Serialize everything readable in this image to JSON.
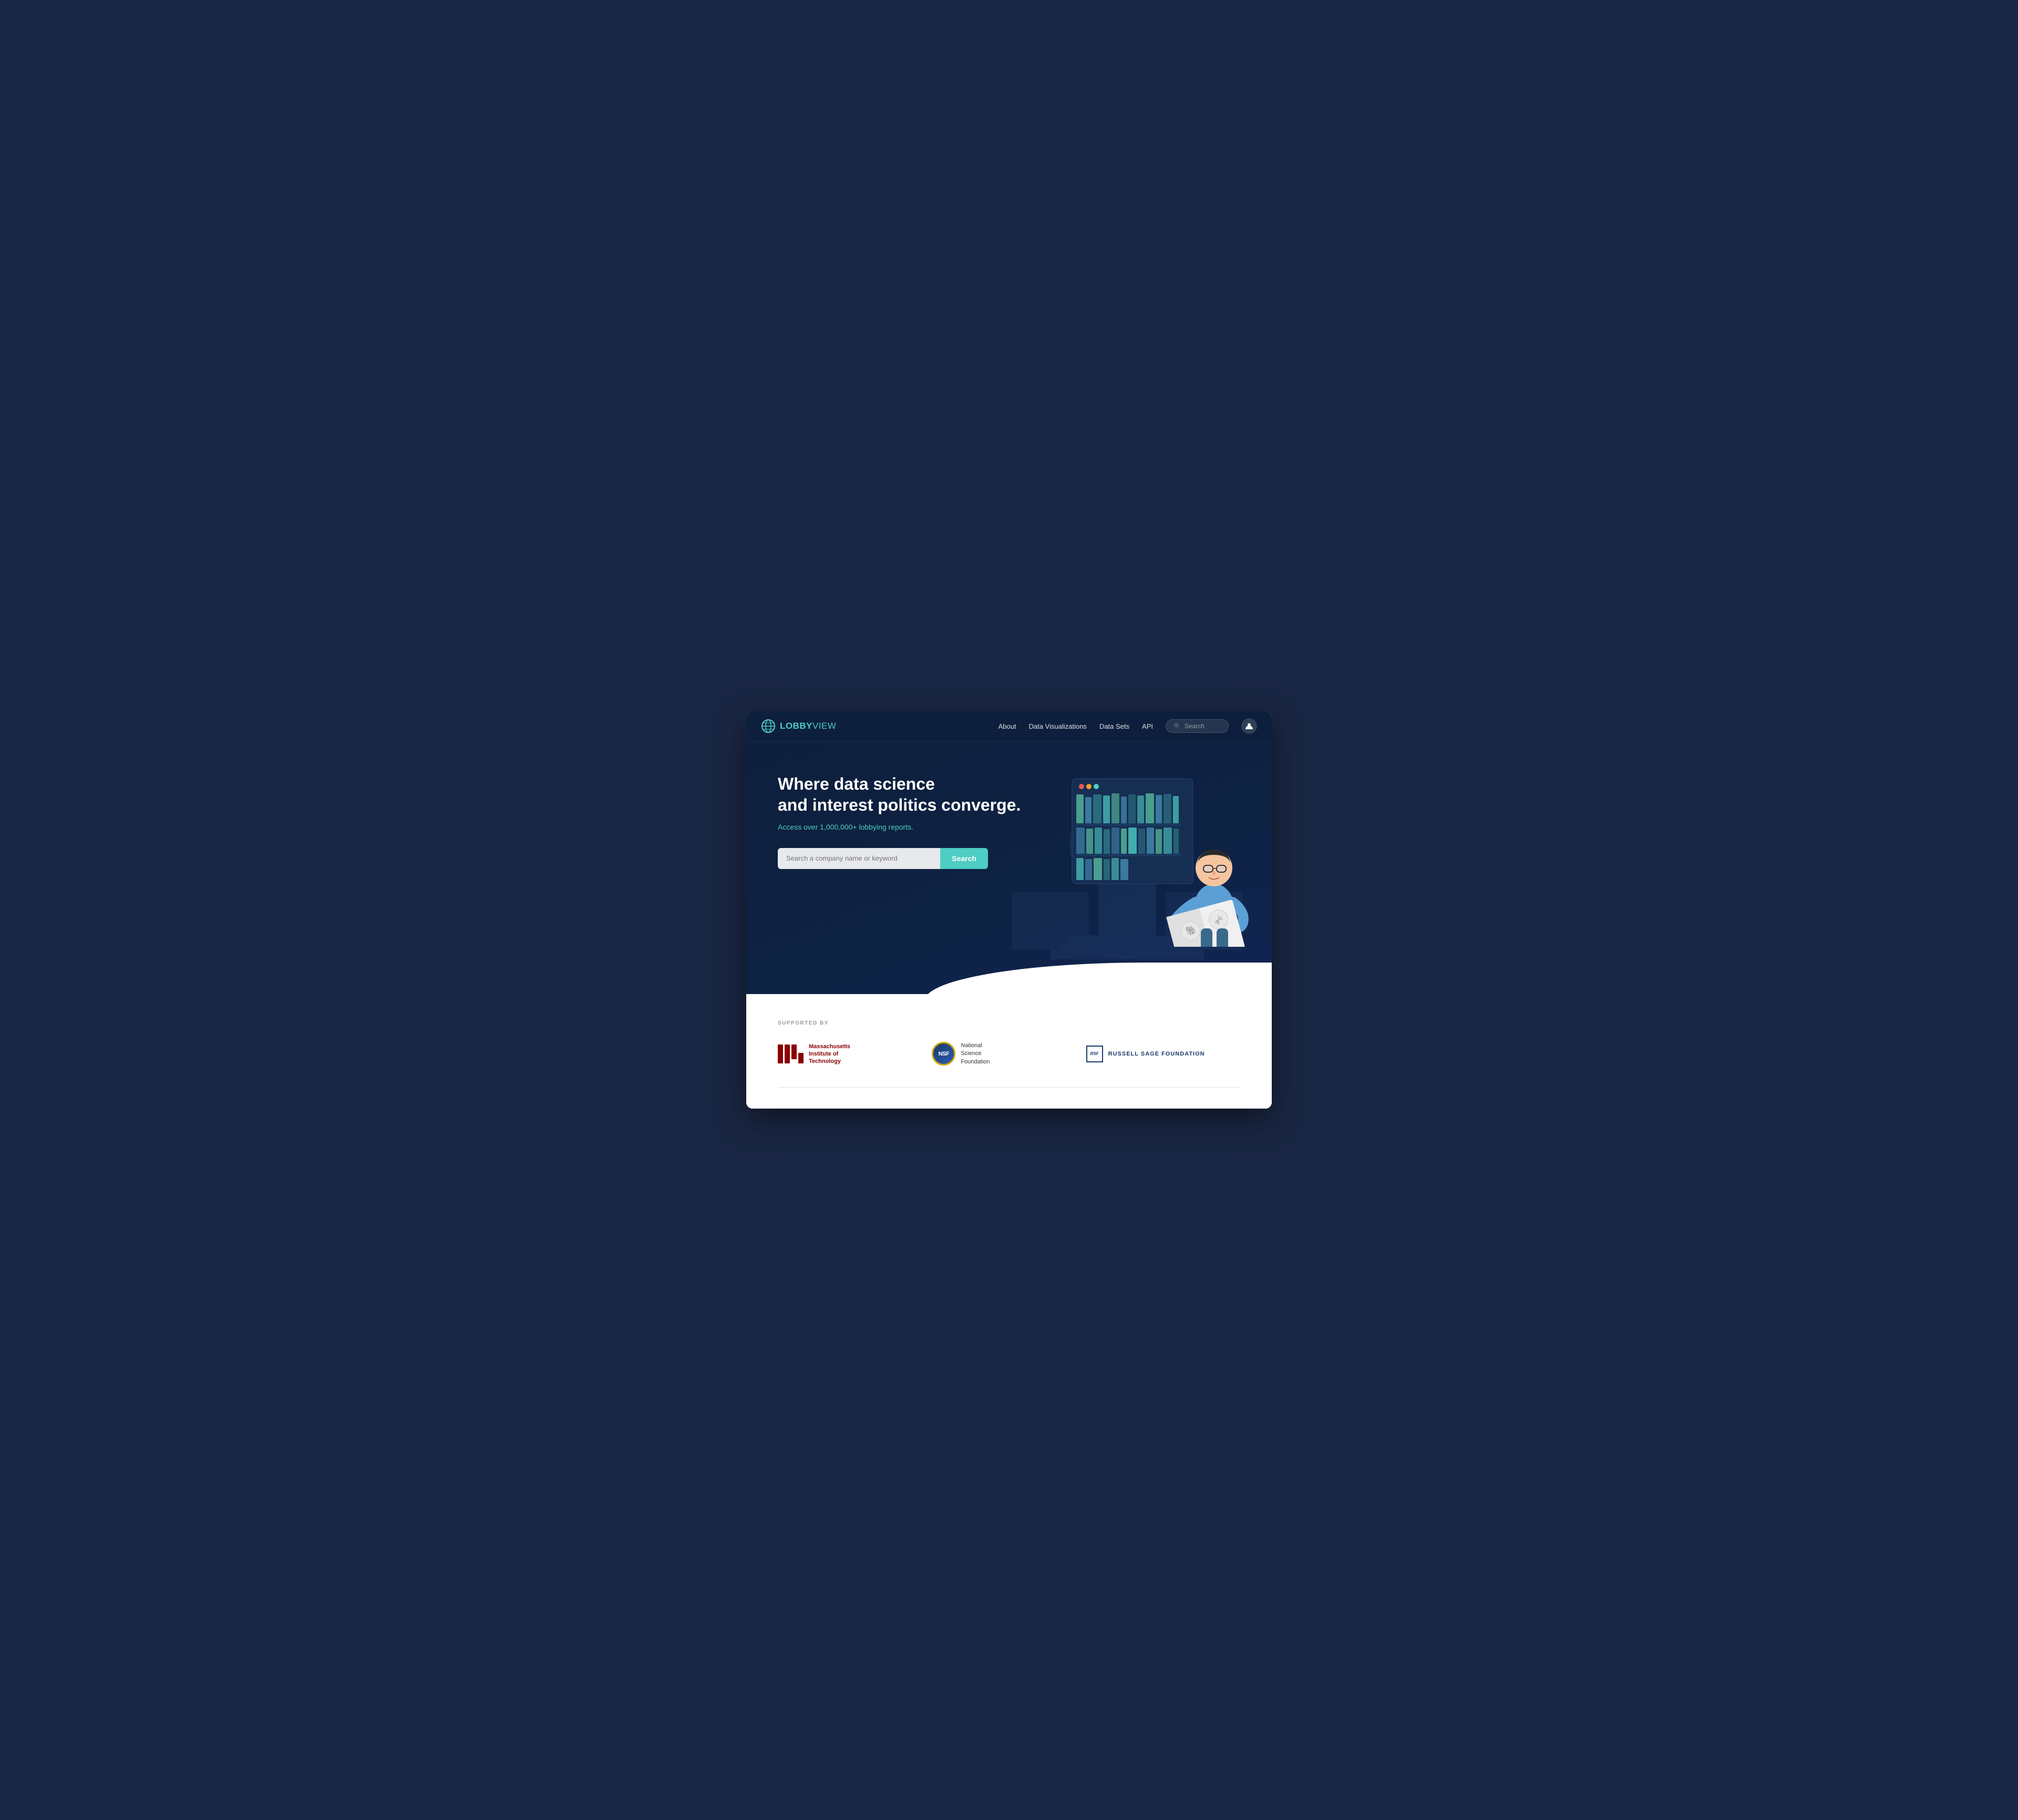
{
  "browser": {
    "nav": {
      "logo_text_bold": "LOBBY",
      "logo_text_light": "VIEW",
      "links": [
        {
          "label": "About",
          "id": "about"
        },
        {
          "label": "Data Visualizations",
          "id": "data-visualizations"
        },
        {
          "label": "Data Sets",
          "id": "data-sets"
        },
        {
          "label": "API",
          "id": "api"
        }
      ],
      "search_placeholder": "Search",
      "user_icon": "👤"
    },
    "hero": {
      "title_line1": "Where data science",
      "title_line2": "and interest politics converge.",
      "subtitle": "Access over 1,000,000+ lobbying reports.",
      "search_placeholder": "Search a company name or keyword",
      "search_button_label": "Search"
    },
    "supported": {
      "label": "SUPPORTED BY",
      "sponsors": [
        {
          "id": "mit",
          "name": "Massachusetts Institute of Technology",
          "short": "MIT",
          "line1": "Massachusetts",
          "line2": "Institute of",
          "line3": "Technology"
        },
        {
          "id": "nsf",
          "name": "National Science Foundation",
          "short": "NSF",
          "line1": "National",
          "line2": "Science",
          "line3": "Foundation"
        },
        {
          "id": "rsf",
          "name": "Russell Sage Foundation",
          "short": "RSF",
          "label": "RUSSELL SAGE FOUNDATION"
        }
      ]
    }
  },
  "colors": {
    "hero_bg": "#0d1f3c",
    "accent": "#4ecdc4",
    "search_btn": "#4ecdc4",
    "mit_red": "#8b0000",
    "nsf_blue": "#1a3a6b",
    "rsf_blue": "#1a3a6b"
  }
}
